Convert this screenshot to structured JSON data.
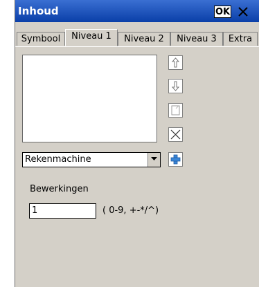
{
  "window": {
    "title": "Inhoud",
    "ok_label": "OK",
    "close_glyph": "×"
  },
  "tabs": [
    {
      "label": "Symbool",
      "active": false
    },
    {
      "label": "Niveau 1",
      "active": true
    },
    {
      "label": "Niveau 2",
      "active": false
    },
    {
      "label": "Niveau 3",
      "active": false
    },
    {
      "label": "Extra",
      "active": false
    }
  ],
  "list": {
    "items": []
  },
  "side_buttons": {
    "up": "up-arrow-icon",
    "down": "down-arrow-icon",
    "edit": "document-icon",
    "delete": "x-icon"
  },
  "combo": {
    "value": "Rekenmachine"
  },
  "add_button_icon": "plus-icon",
  "operations": {
    "label": "Bewerkingen",
    "value": "1",
    "hint": "( 0-9, +-*/^)"
  },
  "colors": {
    "titlebar": "#0a3fa8",
    "window_bg": "#d4d0c8"
  }
}
